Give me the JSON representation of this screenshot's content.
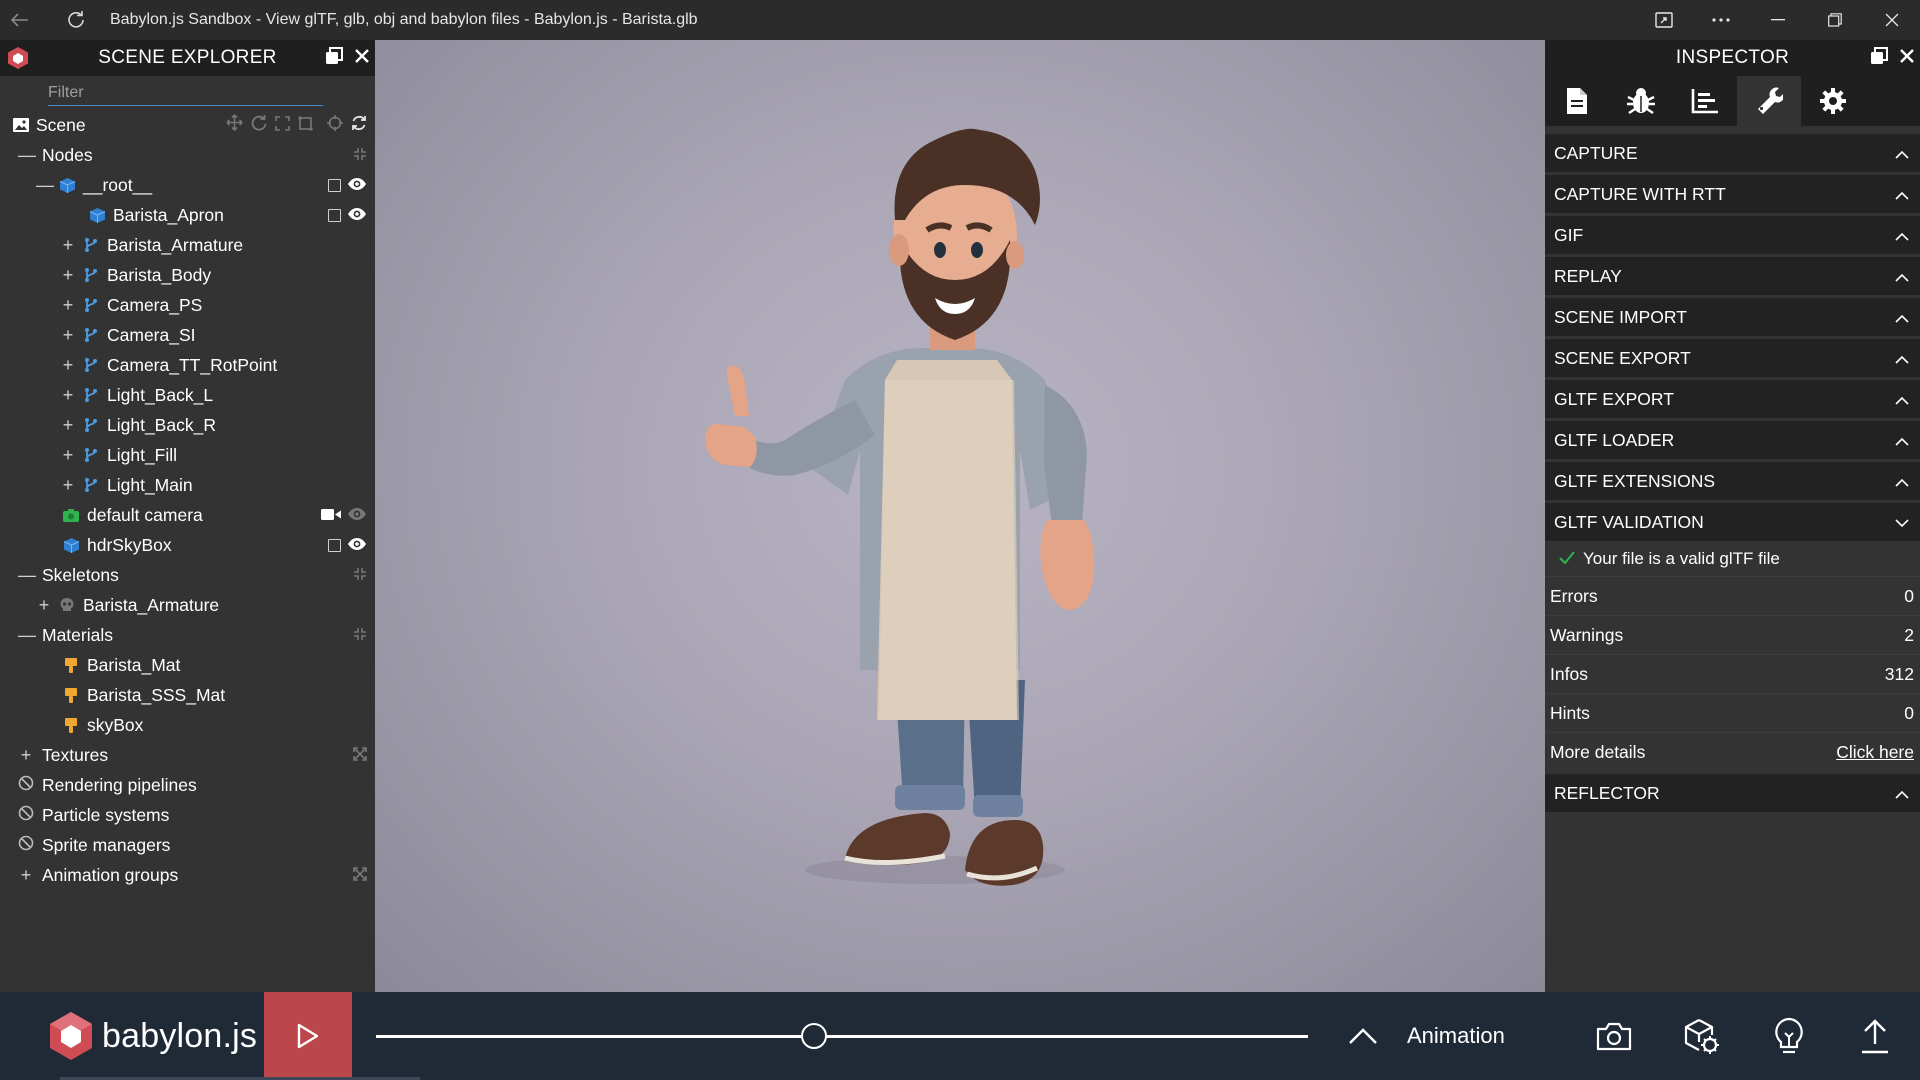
{
  "window": {
    "title": "Babylon.js Sandbox - View glTF, glb, obj and babylon files - Babylon.js - Barista.glb"
  },
  "explorer": {
    "title": "SCENE EXPLORER",
    "filter_placeholder": "Filter",
    "scene_label": "Scene",
    "tree": {
      "nodes": "Nodes",
      "root": "__root__",
      "barista_apron": "Barista_Apron",
      "barista_armature": "Barista_Armature",
      "barista_body": "Barista_Body",
      "camera_ps": "Camera_PS",
      "camera_si": "Camera_SI",
      "camera_tt": "Camera_TT_RotPoint",
      "light_back_l": "Light_Back_L",
      "light_back_r": "Light_Back_R",
      "light_fill": "Light_Fill",
      "light_main": "Light_Main",
      "default_camera": "default camera",
      "hdr_skybox": "hdrSkyBox",
      "skeletons": "Skeletons",
      "skeleton_armature": "Barista_Armature",
      "materials": "Materials",
      "barista_mat": "Barista_Mat",
      "barista_sss_mat": "Barista_SSS_Mat",
      "skybox_mat": "skyBox",
      "textures": "Textures",
      "rendering_pipelines": "Rendering pipelines",
      "particle_systems": "Particle systems",
      "sprite_managers": "Sprite managers",
      "animation_groups": "Animation groups"
    }
  },
  "inspector": {
    "title": "INSPECTOR",
    "tabs": [
      "properties-tab",
      "debug-tab",
      "statistics-tab",
      "tools-tab",
      "settings-tab"
    ],
    "active_tab": "tools-tab",
    "sections": {
      "capture": "CAPTURE",
      "capture_rtt": "CAPTURE WITH RTT",
      "gif": "GIF",
      "replay": "REPLAY",
      "scene_import": "SCENE IMPORT",
      "scene_export": "SCENE EXPORT",
      "gltf_export": "GLTF EXPORT",
      "gltf_loader": "GLTF LOADER",
      "gltf_extensions": "GLTF EXTENSIONS",
      "gltf_validation": "GLTF VALIDATION",
      "reflector": "REFLECTOR"
    },
    "validation": {
      "message": "Your file is a valid glTF file",
      "errors_label": "Errors",
      "errors_value": "0",
      "warnings_label": "Warnings",
      "warnings_value": "2",
      "infos_label": "Infos",
      "infos_value": "312",
      "hints_label": "Hints",
      "hints_value": "0",
      "more_label": "More details",
      "more_link": "Click here"
    }
  },
  "footer": {
    "brand": "babylon.js",
    "animation_label": "Animation",
    "timeline_position": 0.47
  },
  "colors": {
    "panel_bg": "#333333",
    "header_bg": "#1f1f1f",
    "section_bg": "#222222",
    "footer_bg": "#202936",
    "play_bg": "#bb464b",
    "node_icon_blue": "#4a9be0",
    "material_icon": "#f0a830",
    "camera_green": "#2fb34f",
    "logo_red": "#cf4c54"
  }
}
